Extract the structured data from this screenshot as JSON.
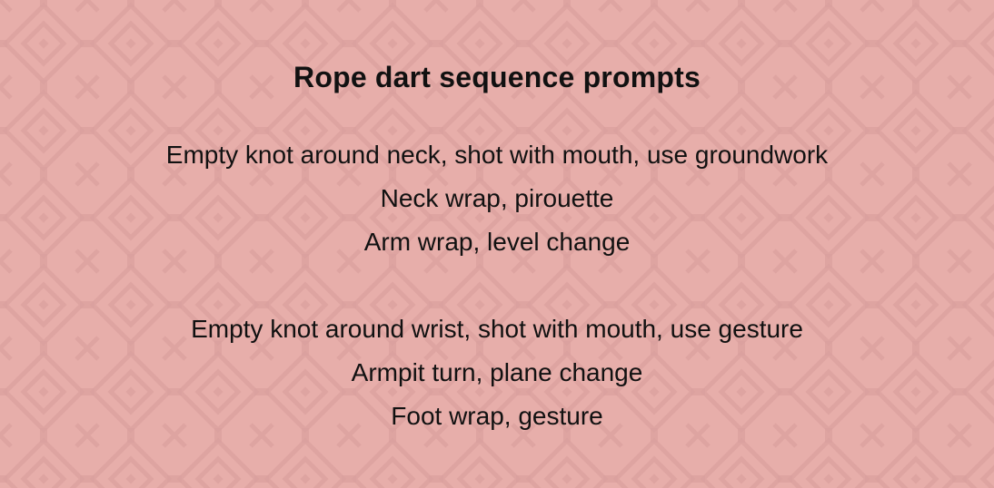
{
  "colors": {
    "background": "#e7aeaa",
    "pattern": "#dba09d",
    "text": "#111111"
  },
  "title": "Rope dart sequence prompts",
  "sequences": [
    {
      "lines": [
        "Empty knot around neck, shot with mouth, use groundwork",
        "Neck wrap, pirouette",
        "Arm wrap, level change"
      ]
    },
    {
      "lines": [
        "Empty knot around wrist, shot with mouth, use gesture",
        "Armpit turn, plane change",
        "Foot wrap, gesture"
      ]
    }
  ]
}
